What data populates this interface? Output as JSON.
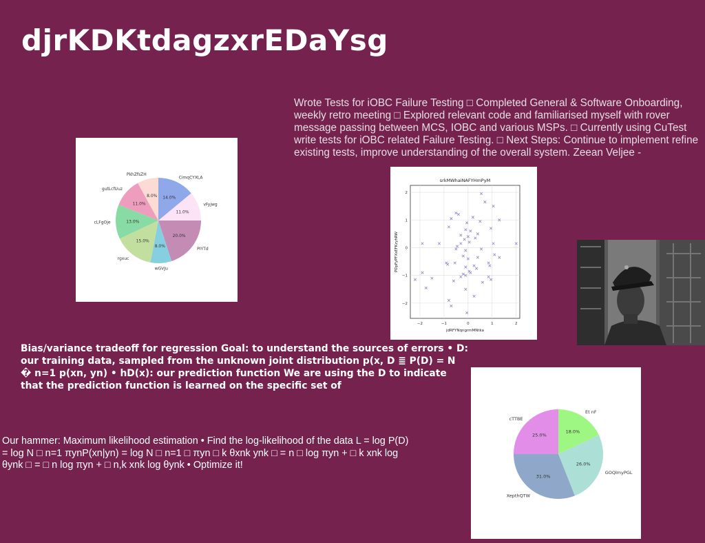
{
  "title": "djrKDKtdagzxrEDaYsg",
  "text_blocks": {
    "top_right": "Wrote Tests for iOBC Failure Testing □ Completed General & Software Onboarding, weekly retro meeting □ Explored relevant code and familiarised myself with rover message passing between MCS, IOBC and various MSPs. □ Currently using CuTest write tests for iOBC related Failure Testing. □ Next Steps: Continue to implement refine existing tests, improve understanding of the overall system. Zeean Veljee -",
    "middle_left": "Bias/variance tradeoff for regression Goal: to understand the sources of errors • D: our training data, sampled from the unknown joint distribution p(x, D ≣ P(D) = N � n=1 p(xn, yn) • hD(x): our prediction function We are using the D to indicate that the prediction function is learned on the specific set of",
    "bottom_left": "Our hammer: Maximum likelihood estimation • Find the log-likelihood of the data L = log P(D) = log N □ n=1 πynP(xn|yn) = log N □ n=1 □ πyn □ k θxnk ynk □ = n □ log πyn + □ k xnk log θynk □ = □ n log πyn + □ n,k xnk log θynk • Optimize it!"
  },
  "chart_data": [
    {
      "type": "pie",
      "labels": [
        "CimqCYXLA",
        "vFyjwg",
        "PIYTd",
        "wGVJu",
        "rgxuc",
        "cLFgOje",
        "gutLcfUuz",
        "PkhZfsZH"
      ],
      "values": [
        14.0,
        11.0,
        20.0,
        8.0,
        15.0,
        13.0,
        11.0,
        8.0
      ],
      "pct_labels": [
        "14.0%",
        "11.0%",
        "20.0%",
        "8.0%",
        "15.0%",
        "13.0%",
        "11.0%",
        "8.0%"
      ],
      "colors": [
        "#8fa8ea",
        "#fde3f6",
        "#c48bb4",
        "#86cfe0",
        "#c3df9f",
        "#88dba5",
        "#ef9dbd",
        "#fddbd5"
      ]
    },
    {
      "type": "scatter",
      "title": "srkMWhaiNAFYHmPyM",
      "xlabel": "jdRFYNqngrmMNtka",
      "ylabel": "PDpFyPFXsEFKzyhRW",
      "xlim": [
        -2.4,
        2.15
      ],
      "ylim": [
        -2.55,
        2.25
      ],
      "xticks": [
        -2,
        -1,
        0,
        1,
        2
      ],
      "yticks": [
        -2,
        -1,
        0,
        1,
        2
      ],
      "marker": "x",
      "color": "#8e86bf",
      "grid": true,
      "points": [
        [
          0.55,
          1.95
        ],
        [
          0.7,
          1.65
        ],
        [
          1.05,
          1.5
        ],
        [
          -0.5,
          1.25
        ],
        [
          -0.4,
          1.2
        ],
        [
          0.2,
          1.1
        ],
        [
          1.3,
          1.0
        ],
        [
          -0.7,
          1.05
        ],
        [
          0.5,
          0.95
        ],
        [
          -0.05,
          0.9
        ],
        [
          -0.8,
          0.75
        ],
        [
          0.95,
          0.7
        ],
        [
          -0.1,
          0.65
        ],
        [
          0.1,
          0.6
        ],
        [
          0.4,
          0.5
        ],
        [
          -0.3,
          0.45
        ],
        [
          0.0,
          0.4
        ],
        [
          0.3,
          0.35
        ],
        [
          -0.15,
          0.3
        ],
        [
          0.05,
          0.2
        ],
        [
          -1.9,
          0.15
        ],
        [
          -1.2,
          0.15
        ],
        [
          -0.3,
          0.15
        ],
        [
          1.05,
          0.15
        ],
        [
          2.0,
          0.15
        ],
        [
          -0.45,
          0.05
        ],
        [
          -0.5,
          -0.05
        ],
        [
          0.55,
          -0.05
        ],
        [
          -0.1,
          -0.1
        ],
        [
          1.1,
          -0.25
        ],
        [
          1.3,
          -0.35
        ],
        [
          0.4,
          -0.35
        ],
        [
          -0.2,
          -0.3
        ],
        [
          0.0,
          -0.4
        ],
        [
          -0.9,
          -0.55
        ],
        [
          -0.55,
          -0.55
        ],
        [
          0.85,
          -0.55
        ],
        [
          -0.85,
          -0.6
        ],
        [
          0.9,
          -0.65
        ],
        [
          0.25,
          -0.65
        ],
        [
          -0.1,
          -0.7
        ],
        [
          0.05,
          -0.85
        ],
        [
          0.35,
          -0.75
        ],
        [
          0.1,
          -0.9
        ],
        [
          -0.2,
          -0.95
        ],
        [
          -0.1,
          -1.0
        ],
        [
          0.85,
          -1.05
        ],
        [
          0.95,
          -1.15
        ],
        [
          -1.5,
          -1.1
        ],
        [
          -2.2,
          -1.15
        ],
        [
          -0.6,
          -1.2
        ],
        [
          -0.3,
          -1.05
        ],
        [
          -1.9,
          -0.9
        ],
        [
          -1.75,
          -1.45
        ],
        [
          0.6,
          -1.25
        ],
        [
          -0.1,
          -1.5
        ],
        [
          0.25,
          -1.75
        ],
        [
          -0.8,
          -1.9
        ],
        [
          -0.7,
          -2.1
        ],
        [
          -0.05,
          -2.35
        ]
      ]
    },
    {
      "type": "pie",
      "labels": [
        "Et nF",
        "GOQlmyPGL",
        "XepthQTW",
        "cTTBE"
      ],
      "values": [
        18.0,
        26.0,
        31.0,
        25.0
      ],
      "pct_labels": [
        "18.0%",
        "26.0%",
        "31.0%",
        "25.0%"
      ],
      "colors": [
        "#9ff783",
        "#acdfd5",
        "#8fa7c8",
        "#e28ee9"
      ]
    }
  ]
}
